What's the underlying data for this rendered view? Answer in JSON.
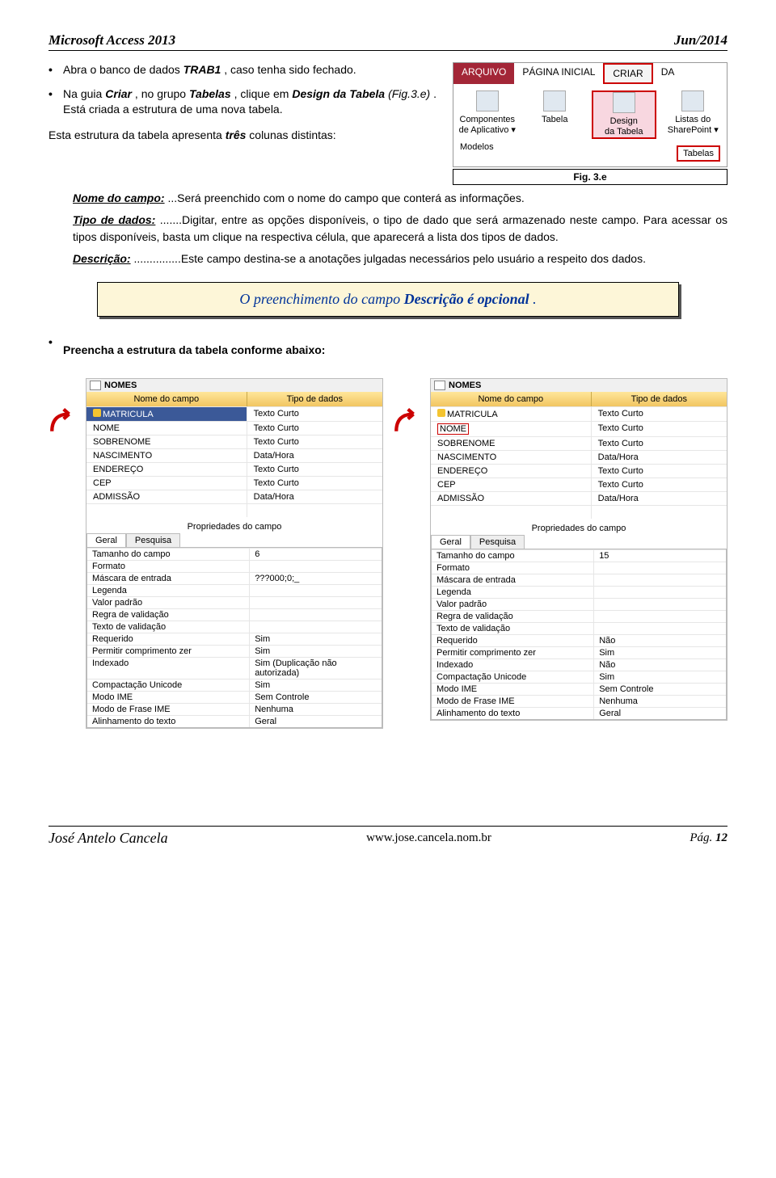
{
  "header": {
    "left": "Microsoft Access 2013",
    "right": "Jun/2014"
  },
  "intro": {
    "b1_pre": "Abra o banco de dados ",
    "b1_strong": "TRAB1",
    "b1_post": ", caso tenha sido fechado.",
    "b2_a": "Na guia ",
    "b2_b": "Criar",
    "b2_c": ", no grupo ",
    "b2_d": "Tabelas",
    "b2_e": ", clique em ",
    "b2_f": "Design da Tabela",
    "b2_g": " (Fig.3.e)",
    "b2_h": ". Está criada a estrutura de uma nova tabela.",
    "p_a": "Esta estrutura da tabela apresenta ",
    "p_b": "três",
    "p_c": " colunas distintas:"
  },
  "ribbon": {
    "tab_arquivo": "ARQUIVO",
    "tab_pagina": "PÁGINA INICIAL",
    "tab_criar": "CRIAR",
    "tab_da": "DA",
    "grp1a": "Componentes",
    "grp1b": "de Aplicativo ▾",
    "grp2": "Tabela",
    "grp3a": "Design",
    "grp3b": "da Tabela",
    "grp4a": "Listas do",
    "grp4b": "SharePoint ▾",
    "sub_modelos": "Modelos",
    "sub_tabelas": "Tabelas",
    "caption": "Fig. 3.e"
  },
  "defs": {
    "nome_label": "Nome do campo:",
    "nome_text": "...Será preenchido com o nome do campo que conterá as informações.",
    "tipo_label": "Tipo de dados:",
    "tipo_text": ".......Digitar, entre as opções disponíveis, o tipo de dado que será armazenado neste campo. Para acessar os tipos disponíveis, basta um clique na respectiva célula, que aparecerá a lista dos tipos de dados.",
    "desc_label": "Descrição:",
    "desc_text": "...............Este campo destina-se a anotações julgadas necessários pelo usuário a respeito dos dados."
  },
  "note": {
    "pre": "O preenchimento do campo ",
    "strong": "Descrição é opcional",
    "post": "."
  },
  "section2": "Preencha a estrutura da tabela conforme abaixo:",
  "shot": {
    "title": "NOMES",
    "col_name": "Nome do campo",
    "col_type": "Tipo de dados",
    "rows_left": [
      {
        "n": "MATRICULA",
        "t": "Texto Curto"
      },
      {
        "n": "NOME",
        "t": "Texto Curto"
      },
      {
        "n": "SOBRENOME",
        "t": "Texto Curto"
      },
      {
        "n": "NASCIMENTO",
        "t": "Data/Hora"
      },
      {
        "n": "ENDEREÇO",
        "t": "Texto Curto"
      },
      {
        "n": "CEP",
        "t": "Texto Curto"
      },
      {
        "n": "ADMISSÃO",
        "t": "Data/Hora"
      }
    ],
    "rows_right": [
      {
        "n": "MATRICULA",
        "t": "Texto Curto"
      },
      {
        "n": "NOME",
        "t": "Texto Curto"
      },
      {
        "n": "SOBRENOME",
        "t": "Texto Curto"
      },
      {
        "n": "NASCIMENTO",
        "t": "Data/Hora"
      },
      {
        "n": "ENDEREÇO",
        "t": "Texto Curto"
      },
      {
        "n": "CEP",
        "t": "Texto Curto"
      },
      {
        "n": "ADMISSÃO",
        "t": "Data/Hora"
      }
    ],
    "prop_caption": "Propriedades do campo",
    "tab_geral": "Geral",
    "tab_pesq": "Pesquisa",
    "props_left": [
      {
        "l": "Tamanho do campo",
        "v": "6"
      },
      {
        "l": "Formato",
        "v": ""
      },
      {
        "l": "Máscara de entrada",
        "v": "???000;0;_"
      },
      {
        "l": "Legenda",
        "v": ""
      },
      {
        "l": "Valor padrão",
        "v": ""
      },
      {
        "l": "Regra de validação",
        "v": ""
      },
      {
        "l": "Texto de validação",
        "v": ""
      },
      {
        "l": "Requerido",
        "v": "Sim"
      },
      {
        "l": "Permitir comprimento zer",
        "v": "Sim"
      },
      {
        "l": "Indexado",
        "v": "Sim (Duplicação não autorizada)"
      },
      {
        "l": "Compactação Unicode",
        "v": "Sim"
      },
      {
        "l": "Modo IME",
        "v": "Sem Controle"
      },
      {
        "l": "Modo de Frase IME",
        "v": "Nenhuma"
      },
      {
        "l": "Alinhamento do texto",
        "v": "Geral"
      }
    ],
    "props_right": [
      {
        "l": "Tamanho do campo",
        "v": "15"
      },
      {
        "l": "Formato",
        "v": ""
      },
      {
        "l": "Máscara de entrada",
        "v": ""
      },
      {
        "l": "Legenda",
        "v": ""
      },
      {
        "l": "Valor padrão",
        "v": ""
      },
      {
        "l": "Regra de validação",
        "v": ""
      },
      {
        "l": "Texto de validação",
        "v": ""
      },
      {
        "l": "Requerido",
        "v": "Não"
      },
      {
        "l": "Permitir comprimento zer",
        "v": "Sim"
      },
      {
        "l": "Indexado",
        "v": "Não"
      },
      {
        "l": "Compactação Unicode",
        "v": "Sim"
      },
      {
        "l": "Modo IME",
        "v": "Sem Controle"
      },
      {
        "l": "Modo de Frase IME",
        "v": "Nenhuma"
      },
      {
        "l": "Alinhamento do texto",
        "v": "Geral"
      }
    ]
  },
  "footer": {
    "author": "José Antelo Cancela",
    "site": "www.jose.cancela.nom.br",
    "page_label": "Pág.",
    "page_num": "12"
  }
}
